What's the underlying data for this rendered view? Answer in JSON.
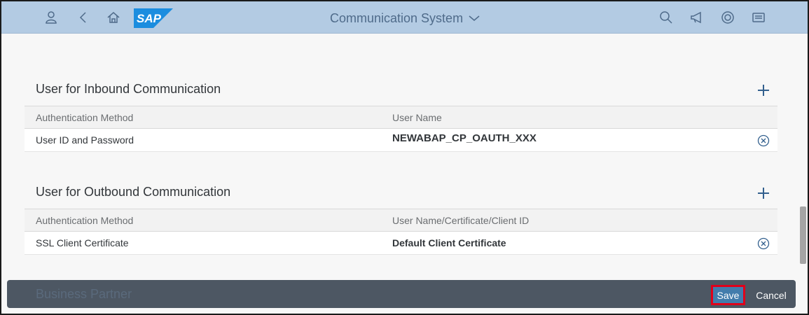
{
  "shell": {
    "title": "Communication System",
    "logo_text": "SAP",
    "icons": {
      "user": "user-icon",
      "back": "back-icon",
      "home": "home-icon",
      "search": "search-icon",
      "notifications": "megaphone-icon",
      "copilot": "copilot-icon",
      "menu": "menu-icon"
    }
  },
  "inbound": {
    "title": "User for Inbound Communication",
    "columns": [
      "Authentication Method",
      "User Name"
    ],
    "rows": [
      {
        "method": "User ID and Password",
        "user": "NEWABAP_CP_OAUTH_XXX"
      }
    ]
  },
  "outbound": {
    "title": "User for Outbound Communication",
    "columns": [
      "Authentication Method",
      "User Name/Certificate/Client ID"
    ],
    "rows": [
      {
        "method": "SSL Client Certificate",
        "user": "Default Client Certificate"
      }
    ]
  },
  "next_section": {
    "title": "Business Partner"
  },
  "footer": {
    "save_label": "Save",
    "cancel_label": "Cancel"
  },
  "colors": {
    "shell_bg": "#b3cbe3",
    "accent": "#33608e",
    "save_bg": "#427cac",
    "highlight": "#e0001a"
  }
}
